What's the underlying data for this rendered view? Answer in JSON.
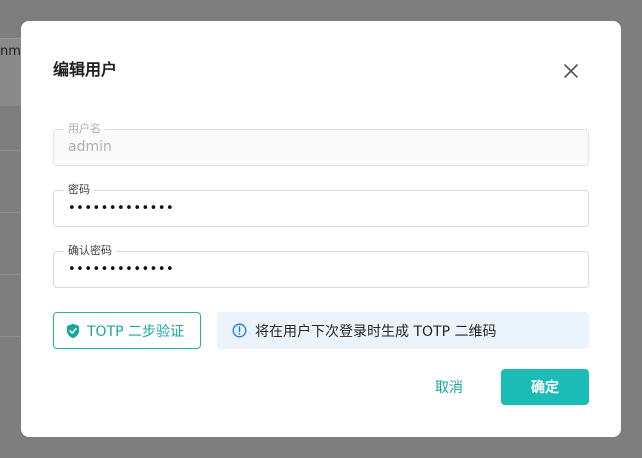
{
  "background": {
    "partial_text": "nmc"
  },
  "dialog": {
    "title": "编辑用户",
    "close_icon": "close-icon",
    "fields": {
      "username": {
        "label": "用户名",
        "value": "admin",
        "disabled": true
      },
      "password": {
        "label": "密码",
        "value": "•••••••••••••"
      },
      "confirm_password": {
        "label": "确认密码",
        "value": "•••••••••••••"
      }
    },
    "totp_button": {
      "label": "TOTP 二步验证",
      "icon": "shield-check-icon"
    },
    "info": {
      "text": "将在用户下次登录时生成 TOTP 二维码",
      "icon": "info-circle-icon"
    },
    "cancel_label": "取消",
    "ok_label": "确定"
  },
  "colors": {
    "accent": "#1cbcb6",
    "accent_text": "#14a89f",
    "info_bg": "#ebf3fd",
    "info_icon": "#1677ff",
    "overlay": "#7e7e7e"
  }
}
